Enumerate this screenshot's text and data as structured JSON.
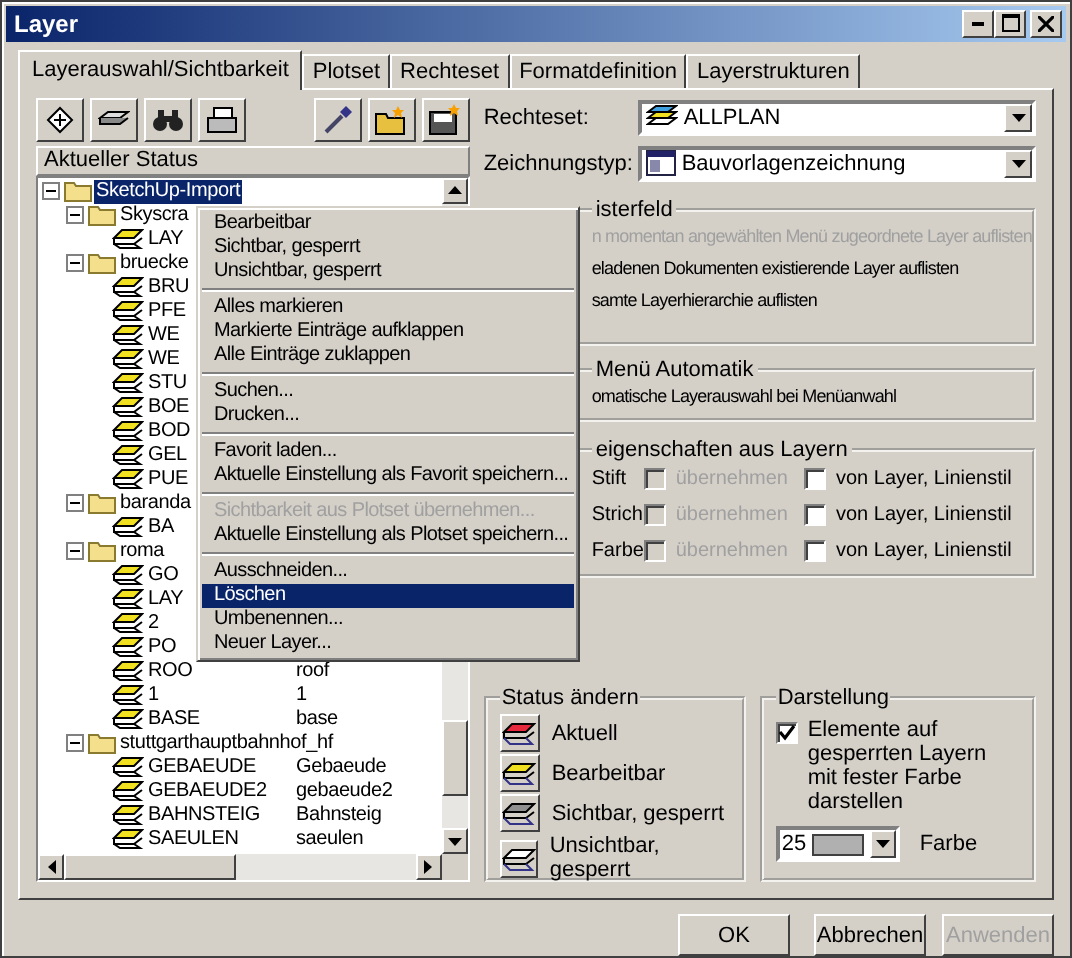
{
  "window": {
    "title": "Layer"
  },
  "tabs": [
    {
      "label": "Layerauswahl/Sichtbarkeit",
      "selected": true
    },
    {
      "label": "Plotset",
      "selected": false
    },
    {
      "label": "Rechteset",
      "selected": false
    },
    {
      "label": "Formatdefinition",
      "selected": false
    },
    {
      "label": "Layerstrukturen",
      "selected": false
    }
  ],
  "tree": {
    "header": "Aktueller Status",
    "nodes": [
      {
        "label": "SketchUp-Import",
        "kind": "folder",
        "expanded": true,
        "selected": true,
        "children": [
          {
            "label": "Skyscra",
            "kind": "folder",
            "expanded": true,
            "selected": false,
            "children": [
              {
                "label": "LAY",
                "kind": "layer",
                "selected": false
              }
            ]
          },
          {
            "label": "bruecke",
            "kind": "folder",
            "expanded": true,
            "selected": false,
            "children": [
              {
                "label": "BRU",
                "kind": "layer",
                "selected": false
              },
              {
                "label": "PFE",
                "kind": "layer",
                "selected": false
              },
              {
                "label": "WE",
                "kind": "layer",
                "selected": false
              },
              {
                "label": "WE",
                "kind": "layer",
                "selected": false
              },
              {
                "label": "STU",
                "kind": "layer",
                "selected": false
              },
              {
                "label": "BOE",
                "kind": "layer",
                "selected": false
              },
              {
                "label": "BOD",
                "kind": "layer",
                "selected": false
              },
              {
                "label": "GEL",
                "kind": "layer",
                "selected": false
              },
              {
                "label": "PUE",
                "kind": "layer",
                "selected": false
              }
            ]
          },
          {
            "label": "baranda",
            "kind": "folder",
            "expanded": true,
            "selected": false,
            "children": [
              {
                "label": "BA",
                "kind": "layer",
                "selected": false
              }
            ]
          },
          {
            "label": "roma",
            "kind": "folder",
            "expanded": true,
            "selected": false,
            "children": [
              {
                "label": "GO",
                "kind": "layer",
                "selected": false
              },
              {
                "label": "LAY",
                "kind": "layer",
                "selected": false
              },
              {
                "label": "2",
                "kind": "layer",
                "selected": false
              },
              {
                "label": "PO",
                "kind": "layer",
                "selected": false
              },
              {
                "label": "ROO",
                "description": "roof",
                "kind": "layer",
                "selected": false
              },
              {
                "label": "1",
                "description": "1",
                "kind": "layer",
                "selected": false
              },
              {
                "label": "BASE",
                "description": "base",
                "kind": "layer",
                "selected": false
              }
            ]
          },
          {
            "label": "stuttgarthauptbahnhof_hf",
            "kind": "folder",
            "expanded": true,
            "selected": false,
            "children": [
              {
                "label": "GEBAEUDE",
                "description": "Gebaeude",
                "kind": "layer",
                "selected": false
              },
              {
                "label": "GEBAEUDE2",
                "description": "gebaeude2",
                "kind": "layer",
                "selected": false
              },
              {
                "label": "BAHNSTEIG",
                "description": "Bahnsteig",
                "kind": "layer",
                "selected": false
              },
              {
                "label": "SAEULEN",
                "description": "saeulen",
                "kind": "layer",
                "selected": false
              }
            ]
          }
        ]
      }
    ]
  },
  "context_menu": {
    "groups": [
      [
        {
          "label": "Bearbeitbar",
          "disabled": false,
          "selected": false
        },
        {
          "label": "Sichtbar, gesperrt",
          "disabled": false,
          "selected": false
        },
        {
          "label": "Unsichtbar, gesperrt",
          "disabled": false,
          "selected": false
        }
      ],
      [
        {
          "label": "Alles markieren",
          "disabled": false,
          "selected": false
        },
        {
          "label": "Markierte Einträge aufklappen",
          "disabled": false,
          "selected": false
        },
        {
          "label": "Alle Einträge zuklappen",
          "disabled": false,
          "selected": false
        }
      ],
      [
        {
          "label": "Suchen...",
          "disabled": false,
          "selected": false
        },
        {
          "label": "Drucken...",
          "disabled": false,
          "selected": false
        }
      ],
      [
        {
          "label": "Favorit laden...",
          "disabled": false,
          "selected": false
        },
        {
          "label": "Aktuelle Einstellung als Favorit speichern...",
          "disabled": false,
          "selected": false
        }
      ],
      [
        {
          "label": "Sichtbarkeit aus Plotset übernehmen...",
          "disabled": true,
          "selected": false
        },
        {
          "label": "Aktuelle Einstellung als Plotset speichern...",
          "disabled": false,
          "selected": false
        }
      ],
      [
        {
          "label": "Ausschneiden...",
          "disabled": false,
          "selected": false
        },
        {
          "label": "Löschen",
          "disabled": false,
          "selected": true
        },
        {
          "label": "Umbenennen...",
          "disabled": false,
          "selected": false
        },
        {
          "label": "Neuer Layer...",
          "disabled": false,
          "selected": false
        }
      ]
    ]
  },
  "rechteset": {
    "label": "Rechteset:",
    "value": "ALLPLAN"
  },
  "zeichnungstyp": {
    "label": "Zeichnungstyp:",
    "value": "Bauvorlagenzeichnung"
  },
  "listenfeld": {
    "title": "isterfeld",
    "options": [
      {
        "label": "n momentan angewählten Menü zugeordnete Layer auflisten",
        "disabled": true
      },
      {
        "label": "eladenen Dokumenten existierende Layer auflisten",
        "disabled": false
      },
      {
        "label": "samte Layerhierarchie auflisten",
        "disabled": false
      }
    ]
  },
  "menu_automatik": {
    "title": "Menü Automatik",
    "options": [
      {
        "label": "omatische Layerauswahl bei Menüanwahl",
        "disabled": false
      }
    ]
  },
  "eigenschaften": {
    "title": "eigenschaften aus Layern",
    "rows": [
      {
        "label": "Stift",
        "take": {
          "label": "übernehmen",
          "checked": false,
          "disabled": true
        },
        "style": {
          "label": "von Layer, Linienstil",
          "checked": false,
          "disabled": false
        }
      },
      {
        "label": "Strich",
        "take": {
          "label": "übernehmen",
          "checked": false,
          "disabled": true
        },
        "style": {
          "label": "von Layer, Linienstil",
          "checked": false,
          "disabled": false
        }
      },
      {
        "label": "Farbe",
        "take": {
          "label": "übernehmen",
          "checked": false,
          "disabled": true
        },
        "style": {
          "label": "von Layer, Linienstil",
          "checked": false,
          "disabled": false
        }
      }
    ]
  },
  "status": {
    "title": "Status ändern",
    "items": [
      {
        "label": "Aktuell",
        "color": "#e8283c"
      },
      {
        "label": "Bearbeitbar",
        "color": "#f0e020"
      },
      {
        "label": "Sichtbar, gesperrt",
        "color": "#909090"
      },
      {
        "label": "Unsichtbar, gesperrt",
        "color": "#ffffff"
      }
    ]
  },
  "darstellung": {
    "title": "Darstellung",
    "checkbox": {
      "label": "Elemente auf gesperrten Layern mit fester Farbe darstellen",
      "checked": true
    },
    "color_field": {
      "value": "25"
    },
    "color_label": "Farbe"
  },
  "buttons": [
    {
      "label": "OK",
      "disabled": false
    },
    {
      "label": "Abbrechen",
      "disabled": false
    },
    {
      "label": "Anwenden",
      "disabled": true
    }
  ]
}
